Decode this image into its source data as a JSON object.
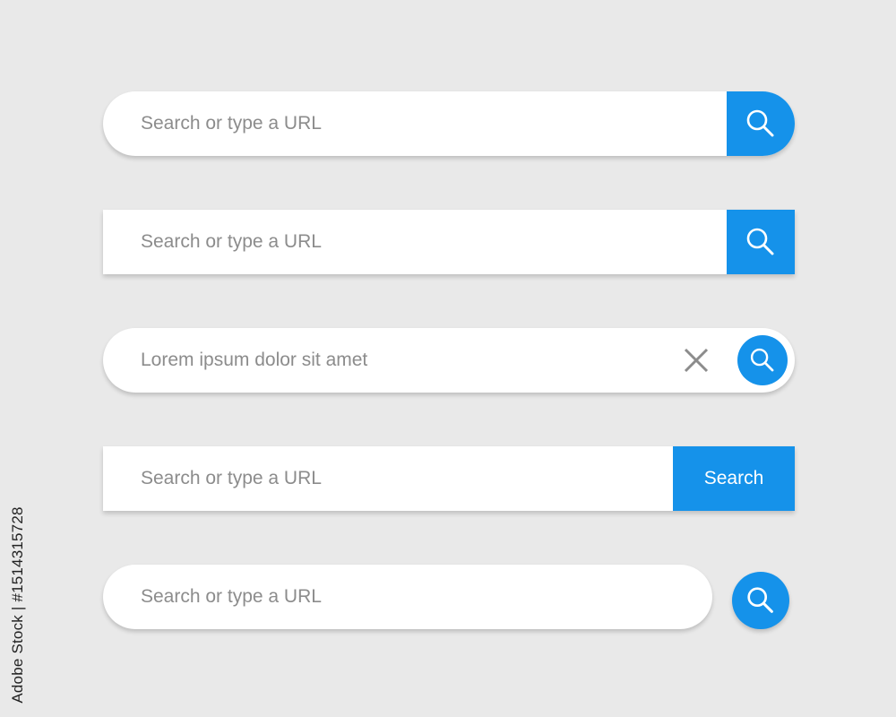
{
  "colors": {
    "background": "#e9e9e9",
    "accent": "#1592ea",
    "field_bg": "#ffffff",
    "placeholder": "#8c8c8c"
  },
  "search_bars": [
    {
      "style": "pill",
      "placeholder": "Search or type a URL",
      "button_icon": "search-icon"
    },
    {
      "style": "rectangle",
      "placeholder": "Search or type a URL",
      "button_icon": "search-icon"
    },
    {
      "style": "pill-with-clear",
      "value": "Lorem ipsum dolor sit amet",
      "clear_icon": "close-icon",
      "button_icon": "search-icon"
    },
    {
      "style": "rectangle-text-button",
      "placeholder": "Search or type a URL",
      "button_label": "Search"
    },
    {
      "style": "pill-separate-button",
      "placeholder": "Search or type a URL",
      "button_icon": "search-icon"
    }
  ],
  "watermark": "Adobe Stock | #1514315728"
}
